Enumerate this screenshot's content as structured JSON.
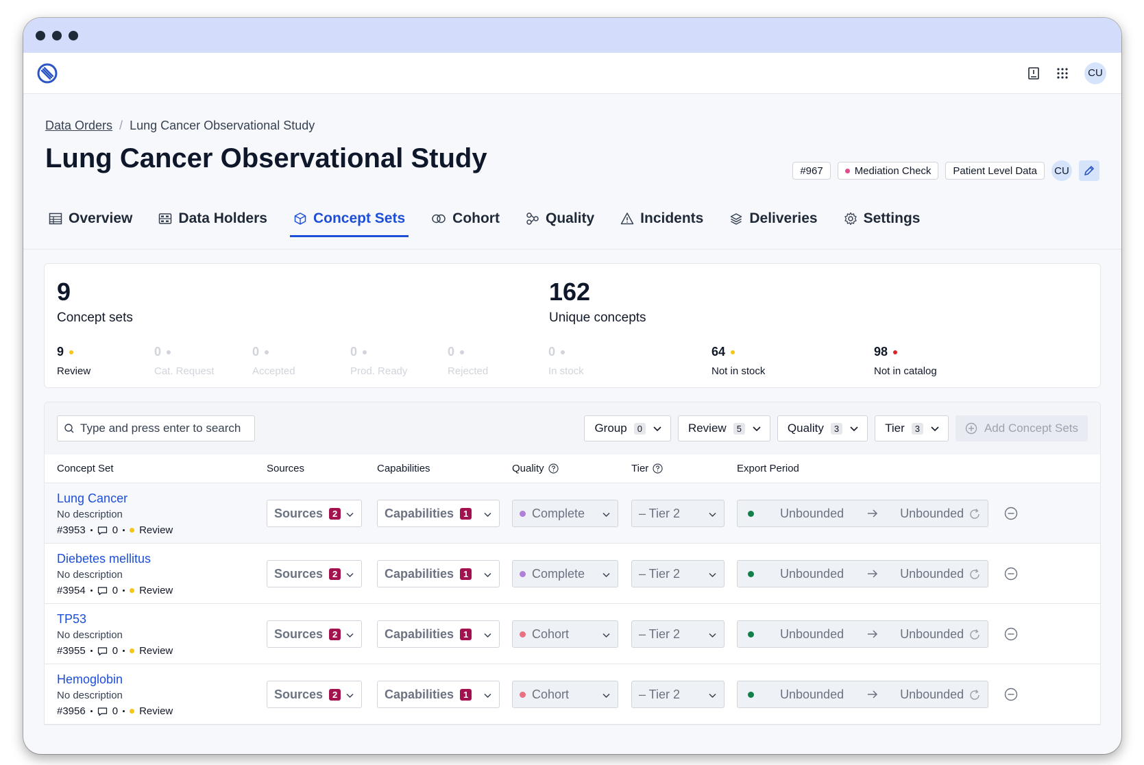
{
  "window": {
    "dots": 3
  },
  "topbar": {
    "user_initials": "CU",
    "icons": [
      "book-icon",
      "apps-grid-icon"
    ]
  },
  "breadcrumb": {
    "parent": "Data Orders",
    "current": "Lung Cancer Observational Study"
  },
  "page": {
    "title": "Lung Cancer Observational Study",
    "id_badge": "#967",
    "status_badge": "Mediation Check",
    "type_badge": "Patient Level Data",
    "owner_initials": "CU"
  },
  "tabs": [
    {
      "label": "Overview",
      "icon": "table-icon",
      "active": false
    },
    {
      "label": "Data Holders",
      "icon": "server-icon",
      "active": false
    },
    {
      "label": "Concept Sets",
      "icon": "cube-icon",
      "active": true
    },
    {
      "label": "Cohort",
      "icon": "rings-icon",
      "active": false
    },
    {
      "label": "Quality",
      "icon": "workflow-icon",
      "active": false
    },
    {
      "label": "Incidents",
      "icon": "warning-icon",
      "active": false
    },
    {
      "label": "Deliveries",
      "icon": "layers-icon",
      "active": false
    },
    {
      "label": "Settings",
      "icon": "gear-icon",
      "active": false
    }
  ],
  "summary": {
    "concept_sets": {
      "value": "9",
      "label": "Concept sets"
    },
    "unique_concepts": {
      "value": "162",
      "label": "Unique concepts"
    },
    "statuses": [
      {
        "value": "9",
        "label": "Review",
        "color": "#f5c518",
        "muted": false
      },
      {
        "value": "0",
        "label": "Cat. Request",
        "color": "#d1d5db",
        "muted": true
      },
      {
        "value": "0",
        "label": "Accepted",
        "color": "#d1d5db",
        "muted": true
      },
      {
        "value": "0",
        "label": "Prod. Ready",
        "color": "#d1d5db",
        "muted": true
      },
      {
        "value": "0",
        "label": "Rejected",
        "color": "#d1d5db",
        "muted": true
      },
      {
        "value": "0",
        "label": "In stock",
        "color": "#d1d5db",
        "muted": true
      },
      {
        "value": "64",
        "label": "Not in stock",
        "color": "#f5c518",
        "muted": false
      },
      {
        "value": "98",
        "label": "Not in catalog",
        "color": "#dc2626",
        "muted": false
      }
    ]
  },
  "toolbar": {
    "search_placeholder": "Type and press enter to search",
    "filters": [
      {
        "label": "Group",
        "count": "0"
      },
      {
        "label": "Review",
        "count": "5"
      },
      {
        "label": "Quality",
        "count": "3"
      },
      {
        "label": "Tier",
        "count": "3"
      }
    ],
    "add_label": "Add Concept Sets"
  },
  "table": {
    "headers": {
      "concept_set": "Concept Set",
      "sources": "Sources",
      "capabilities": "Capabilities",
      "quality": "Quality",
      "tier": "Tier",
      "export_period": "Export Period"
    },
    "rows": [
      {
        "name": "Lung Cancer",
        "description": "No description",
        "id": "#3953",
        "comments": "0",
        "status": "Review",
        "sources_label": "Sources",
        "sources_count": "2",
        "capabilities_label": "Capabilities",
        "capabilities_count": "1",
        "quality": "Complete",
        "quality_color": "#b07fd6",
        "tier": "– Tier 2",
        "export_from": "Unbounded",
        "export_to": "Unbounded"
      },
      {
        "name": "Diebetes mellitus",
        "description": "No description",
        "id": "#3954",
        "comments": "0",
        "status": "Review",
        "sources_label": "Sources",
        "sources_count": "2",
        "capabilities_label": "Capabilities",
        "capabilities_count": "1",
        "quality": "Complete",
        "quality_color": "#b07fd6",
        "tier": "– Tier 2",
        "export_from": "Unbounded",
        "export_to": "Unbounded"
      },
      {
        "name": "TP53",
        "description": "No description",
        "id": "#3955",
        "comments": "0",
        "status": "Review",
        "sources_label": "Sources",
        "sources_count": "2",
        "capabilities_label": "Capabilities",
        "capabilities_count": "1",
        "quality": "Cohort",
        "quality_color": "#e8727f",
        "tier": "– Tier 2",
        "export_from": "Unbounded",
        "export_to": "Unbounded"
      },
      {
        "name": "Hemoglobin",
        "description": "No description",
        "id": "#3956",
        "comments": "0",
        "status": "Review",
        "sources_label": "Sources",
        "sources_count": "2",
        "capabilities_label": "Capabilities",
        "capabilities_count": "1",
        "quality": "Cohort",
        "quality_color": "#e8727f",
        "tier": "– Tier 2",
        "export_from": "Unbounded",
        "export_to": "Unbounded"
      }
    ]
  },
  "colors": {
    "accent": "#1d4ed8",
    "window_bar": "#d3dcfb",
    "count_badge": "#a3124f",
    "export_dot": "#12804b"
  }
}
